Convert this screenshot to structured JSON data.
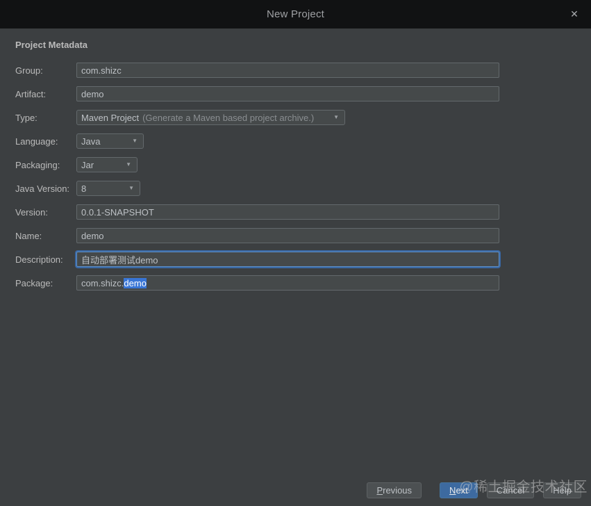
{
  "window": {
    "title": "New Project"
  },
  "icons": {
    "close": "✕",
    "dropdown_arrow": "▼"
  },
  "colors": {
    "titlebar_bg": "#111213",
    "dialog_bg": "#3c3f41",
    "field_bg": "#45494a",
    "field_border": "#63696c",
    "focus_ring": "#3a68a4",
    "selection_bg": "#3875d6",
    "primary_button_bg": "#3d6aa0",
    "label_text": "#bbbbbb"
  },
  "section_title": "Project Metadata",
  "form": {
    "rows": [
      {
        "label": "Group:",
        "value": "com.shizc"
      },
      {
        "label": "Artifact:",
        "value": "demo"
      },
      {
        "label": "Type:",
        "value": "Maven Project",
        "hint": "(Generate a Maven based project archive.)"
      },
      {
        "label": "Language:",
        "value": "Java"
      },
      {
        "label": "Packaging:",
        "value": "Jar"
      },
      {
        "label": "Java Version:",
        "value": "8"
      },
      {
        "label": "Version:",
        "value": "0.0.1-SNAPSHOT"
      },
      {
        "label": "Name:",
        "value": "demo"
      },
      {
        "label": "Description:",
        "value": "自动部署测试demo"
      },
      {
        "label": "Package:",
        "value_prefix": "com.shizc.",
        "value_selected": "demo"
      }
    ]
  },
  "footer": {
    "buttons": {
      "previous": "Previous",
      "next": "Next",
      "cancel": "Cancel",
      "help": "Help"
    },
    "watermark": "@稀土掘金技术社区"
  }
}
